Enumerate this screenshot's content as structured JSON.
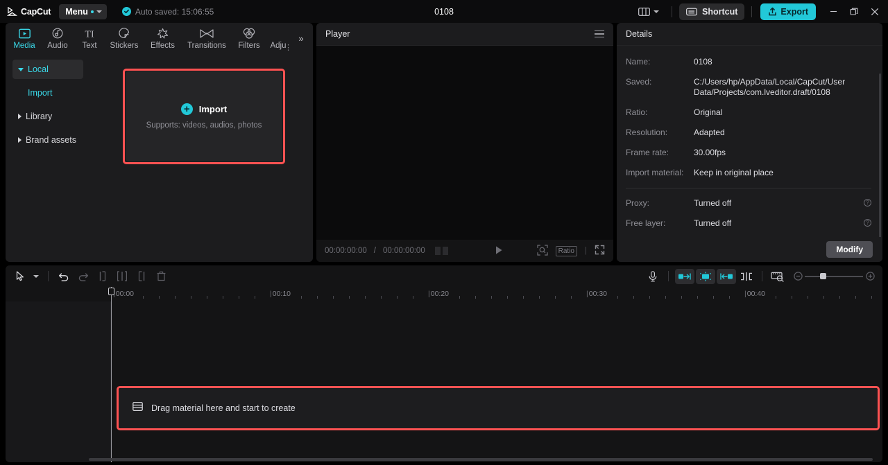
{
  "app": {
    "brand": "CapCut",
    "menu_label": "Menu",
    "autosave_text": "Auto saved: 15:06:55",
    "project_title": "0108"
  },
  "titlebar": {
    "layout_icon": "layout-icon",
    "shortcut_label": "Shortcut",
    "export_label": "Export",
    "minimize": "minimize-icon",
    "maximize": "maximize-icon",
    "close": "close-icon"
  },
  "media_tabs": [
    {
      "label": "Media",
      "icon": "media-icon",
      "active": true
    },
    {
      "label": "Audio",
      "icon": "audio-icon",
      "active": false
    },
    {
      "label": "Text",
      "icon": "text-icon",
      "active": false
    },
    {
      "label": "Stickers",
      "icon": "stickers-icon",
      "active": false
    },
    {
      "label": "Effects",
      "icon": "effects-icon",
      "active": false
    },
    {
      "label": "Transitions",
      "icon": "transitions-icon",
      "active": false
    },
    {
      "label": "Filters",
      "icon": "filters-icon",
      "active": false
    },
    {
      "label": "Adju",
      "icon": "adjust-icon",
      "active": false
    }
  ],
  "tab_overflow_label": "»",
  "sidebar": {
    "items": [
      {
        "label": "Local",
        "selected": true,
        "expanded": true
      },
      {
        "label": "Import",
        "selected": false,
        "sub": true
      },
      {
        "label": "Library",
        "selected": false,
        "expanded": false
      },
      {
        "label": "Brand assets",
        "selected": false,
        "expanded": false
      }
    ]
  },
  "dropzone": {
    "title": "Import",
    "subtitle": "Supports: videos, audios, photos"
  },
  "player": {
    "title": "Player",
    "current_time": "00:00:00:00",
    "total_time": "00:00:00:00",
    "time_separator": "/",
    "ratio_label": "Ratio",
    "sep": "|"
  },
  "details": {
    "title": "Details",
    "rows": [
      {
        "label": "Name:",
        "value": "0108"
      },
      {
        "label": "Saved:",
        "value": "C:/Users/hp/AppData/Local/CapCut/User Data/Projects/com.lveditor.draft/0108"
      },
      {
        "label": "Ratio:",
        "value": "Original"
      },
      {
        "label": "Resolution:",
        "value": "Adapted"
      },
      {
        "label": "Frame rate:",
        "value": "30.00fps"
      },
      {
        "label": "Import material:",
        "value": "Keep in original place"
      }
    ],
    "toggle_rows": [
      {
        "label": "Proxy:",
        "value": "Turned off",
        "help": "?"
      },
      {
        "label": "Free layer:",
        "value": "Turned off",
        "help": "?"
      }
    ],
    "modify_label": "Modify"
  },
  "timeline": {
    "ruler_marks": [
      "00:00",
      "00:10",
      "00:20",
      "00:30",
      "00:40"
    ],
    "drag_hint": "Drag material here and start to create",
    "tools": [
      "select-tool",
      "undo",
      "redo",
      "split-left",
      "split",
      "split-right",
      "delete"
    ],
    "right_tools": [
      "microphone",
      "audio-in",
      "audio-center",
      "audio-out",
      "split-clip",
      "speed-ramp"
    ]
  },
  "colors": {
    "accent": "#22c8d8",
    "annotation": "#ff5252",
    "panel_bg": "#1c1c1e",
    "window_bg": "#0c0c0d"
  }
}
